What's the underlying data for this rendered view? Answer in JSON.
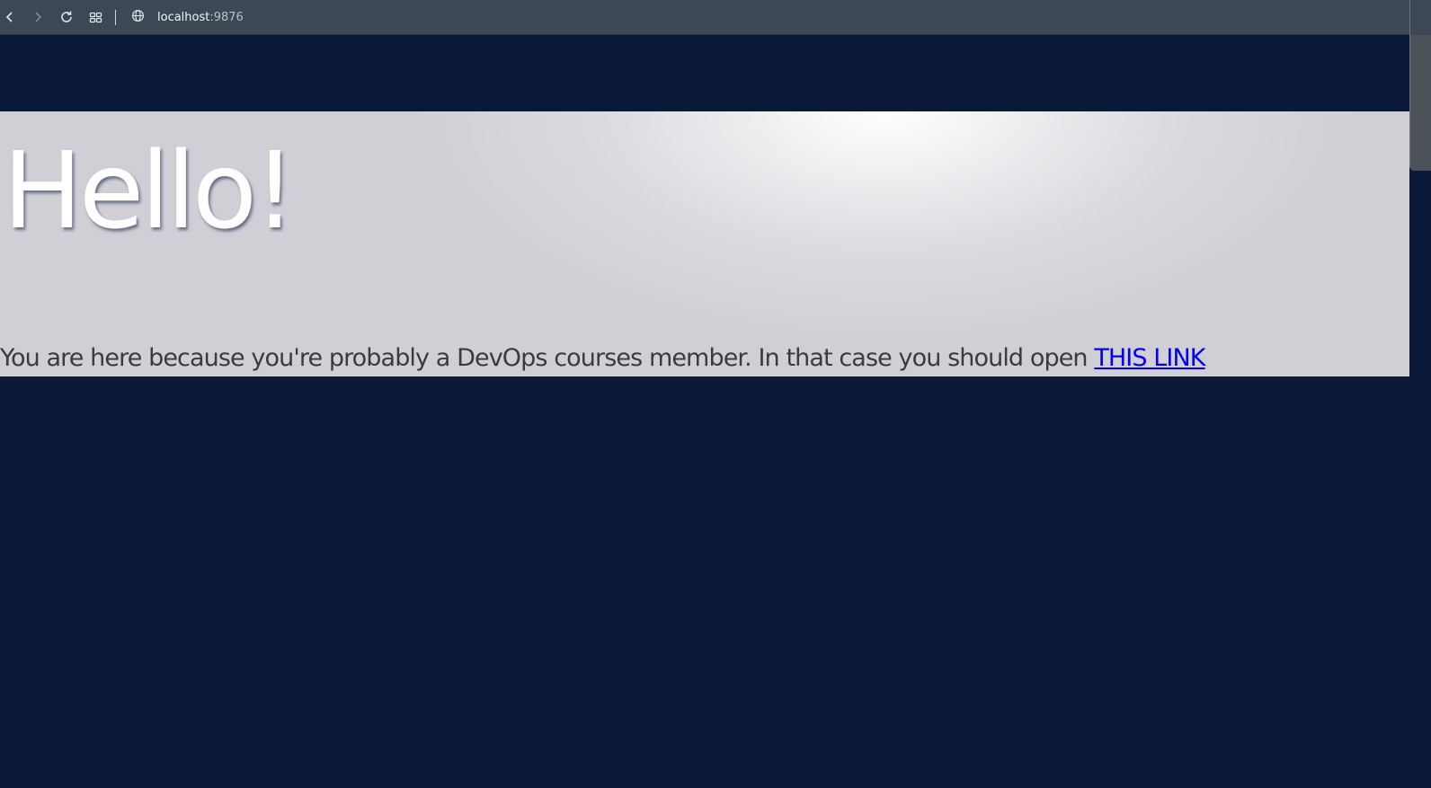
{
  "browser": {
    "url_host": "localhost",
    "url_port": ":9876",
    "icons": [
      "back-icon",
      "forward-icon",
      "reload-icon",
      "tabs-grid-icon",
      "globe-icon"
    ]
  },
  "page": {
    "title": "Hello!",
    "message": "You are here because you're probably a DevOps courses member. In that case you should open ",
    "link_label": "THIS LINK"
  },
  "colors": {
    "page_background": "#0a1839",
    "toolbar": "#3c4954",
    "link": "#0000ee"
  }
}
